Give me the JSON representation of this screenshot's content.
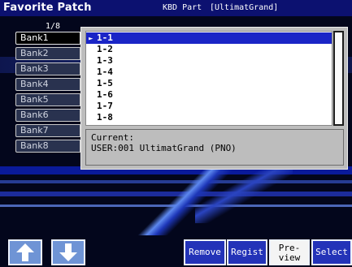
{
  "header": {
    "title": "Favorite Patch",
    "part_label": "KBD Part",
    "part_value": "[UltimatGrand]"
  },
  "bank_list": {
    "page_indicator": "1/8",
    "banks": [
      "Bank1",
      "Bank2",
      "Bank3",
      "Bank4",
      "Bank5",
      "Bank6",
      "Bank7",
      "Bank8"
    ],
    "selected_index": 0
  },
  "popup": {
    "items": [
      "1-1",
      "1-2",
      "1-3",
      "1-4",
      "1-5",
      "1-6",
      "1-7",
      "1-8"
    ],
    "selected_index": 0,
    "current_label": "Current:",
    "current_value": "USER:001 UltimatGrand (PNO)"
  },
  "footer": {
    "up_icon": "arrow-up-icon",
    "down_icon": "arrow-down-icon",
    "remove_label": "Remove",
    "regist_label": "Regist",
    "preview_label_line1": "Pre-",
    "preview_label_line2": "view",
    "select_label": "Select"
  },
  "colors": {
    "title_bar": "#0c1170",
    "selection": "#1a25c6",
    "button_blue": "#2333b8",
    "arrow_button": "#6f94d5"
  }
}
